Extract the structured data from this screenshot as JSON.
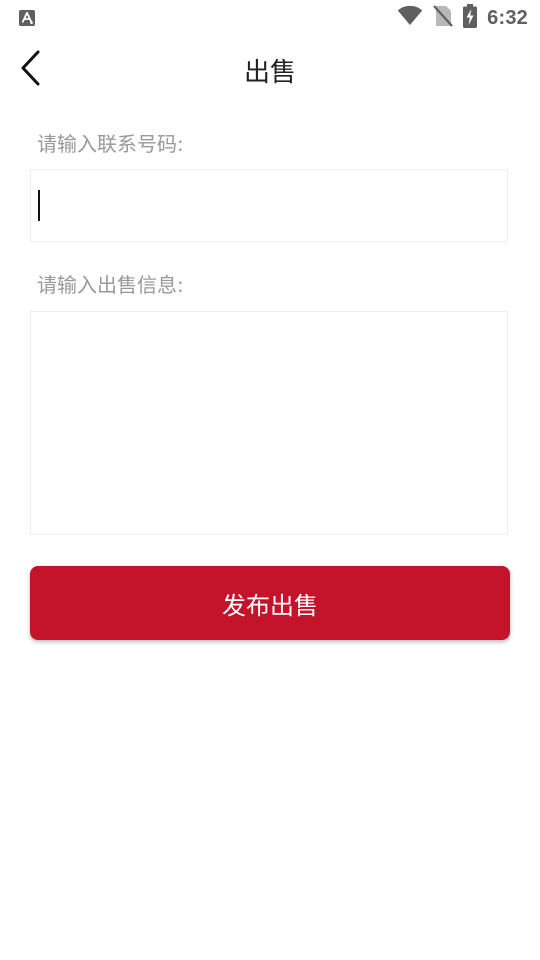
{
  "status_bar": {
    "time": "6:32",
    "left_icon": "text-a-icon",
    "icons": [
      "wifi-icon",
      "no-sim-icon",
      "battery-charging-icon"
    ]
  },
  "header": {
    "back_icon": "chevron-left-icon",
    "title": "出售"
  },
  "form": {
    "phone_label": "请输入联系号码:",
    "phone_value": "",
    "info_label": "请输入出售信息:",
    "info_value": ""
  },
  "submit": {
    "label": "发布出售",
    "color": "#c4142b"
  }
}
